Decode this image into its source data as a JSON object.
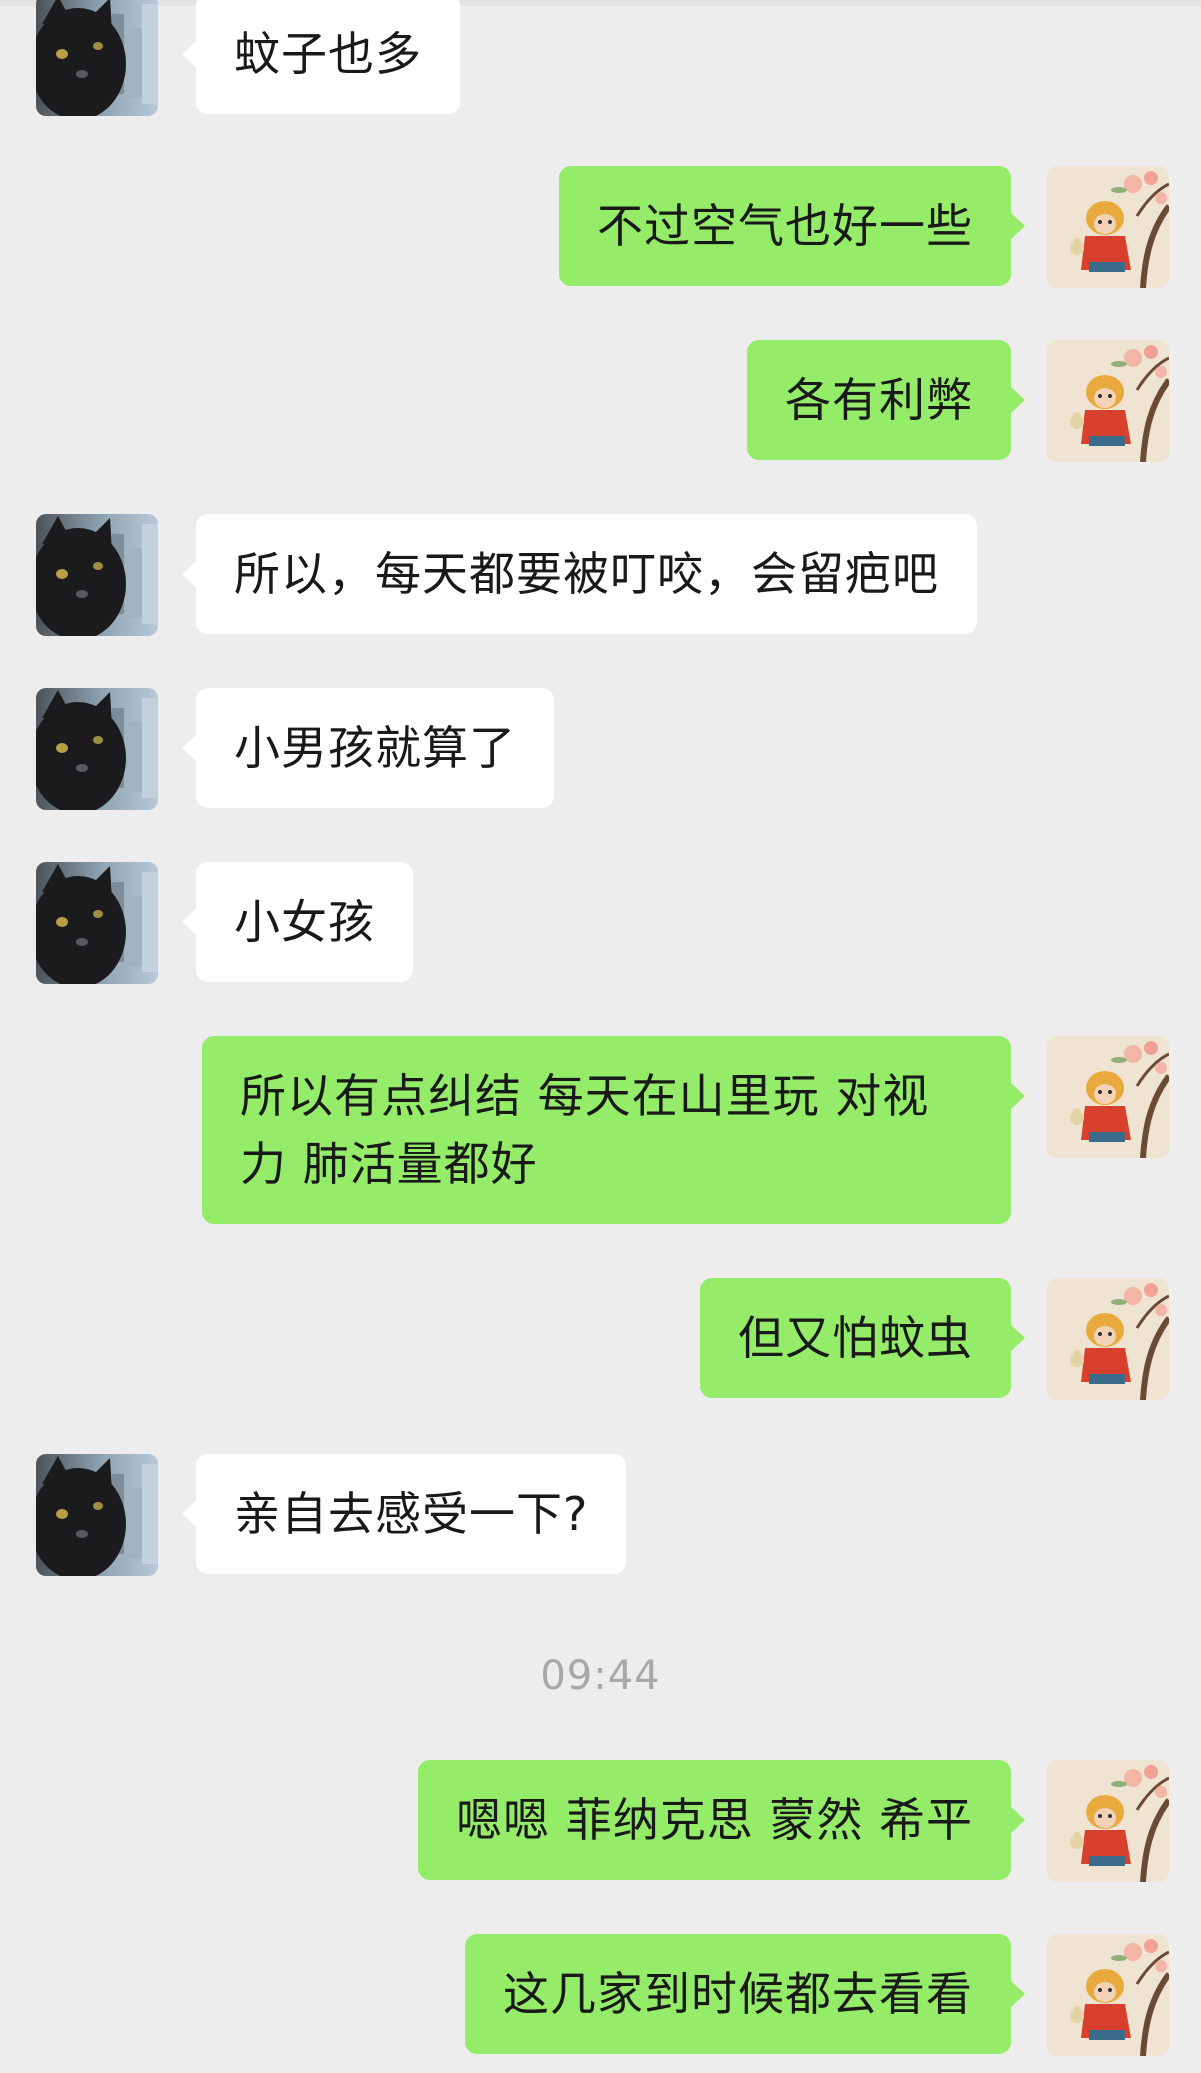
{
  "messages": [
    {
      "side": "left",
      "text": "蚊子也多",
      "avatar": "black-cat-avatar"
    },
    {
      "side": "right",
      "text": "不过空气也好一些",
      "avatar": "monkey-king-avatar"
    },
    {
      "side": "right",
      "text": "各有利弊",
      "avatar": "monkey-king-avatar"
    },
    {
      "side": "left",
      "text": "所以，每天都要被叮咬，会留疤吧",
      "avatar": "black-cat-avatar"
    },
    {
      "side": "left",
      "text": "小男孩就算了",
      "avatar": "black-cat-avatar"
    },
    {
      "side": "left",
      "text": "小女孩",
      "avatar": "black-cat-avatar"
    },
    {
      "side": "right",
      "text": "所以有点纠结 每天在山里玩 对视力 肺活量都好",
      "avatar": "monkey-king-avatar"
    },
    {
      "side": "right",
      "text": "但又怕蚊虫",
      "avatar": "monkey-king-avatar"
    },
    {
      "side": "left",
      "text": "亲自去感受一下?",
      "avatar": "black-cat-avatar"
    },
    {
      "side": "right",
      "text": "嗯嗯 菲纳克思 蒙然 希平",
      "avatar": "monkey-king-avatar"
    },
    {
      "side": "right",
      "text": "这几家到时候都去看看",
      "avatar": "monkey-king-avatar"
    }
  ],
  "timestamp": "09:44",
  "colors": {
    "background": "#ededed",
    "sent_bubble": "#95ec69",
    "received_bubble": "#ffffff",
    "timestamp_text": "#a8a8a8"
  }
}
